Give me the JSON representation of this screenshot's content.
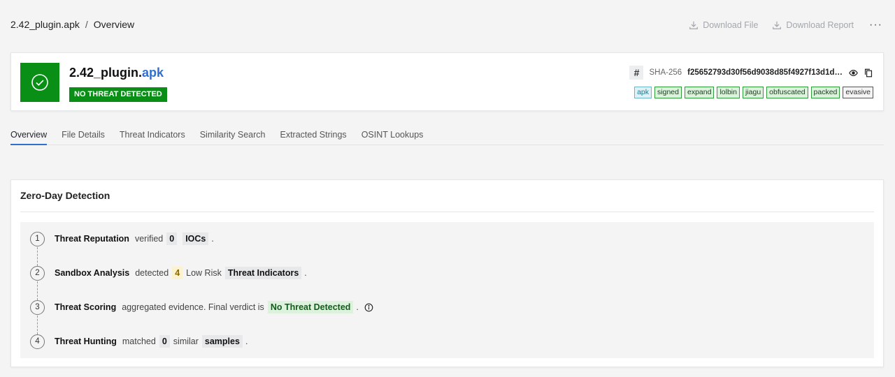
{
  "breadcrumb": {
    "file": "2.42_plugin.apk",
    "separator": "/",
    "page": "Overview"
  },
  "actions": {
    "download_file": "Download File",
    "download_report": "Download Report",
    "more": "···"
  },
  "file": {
    "name_base": "2.42_plugin.",
    "name_ext": "apk",
    "verdict": "NO THREAT DETECTED",
    "hash_symbol": "#",
    "hash_label": "SHA-256",
    "hash_value": "f25652793d30f56d9038d85f4927f13d1d…",
    "tags": [
      "apk",
      "signed",
      "expand",
      "lolbin",
      "jiagu",
      "obfuscated",
      "packed",
      "evasive"
    ]
  },
  "tabs": [
    "Overview",
    "File Details",
    "Threat Indicators",
    "Similarity Search",
    "Extracted Strings",
    "OSINT Lookups"
  ],
  "panel": {
    "title": "Zero-Day Detection",
    "steps": [
      {
        "num": "1",
        "label": "Threat Reputation",
        "t1": "verified",
        "chip1": "0",
        "chip2": "IOCs",
        "end": "."
      },
      {
        "num": "2",
        "label": "Sandbox Analysis",
        "t1": "detected",
        "chip1": "4",
        "t2": "Low Risk",
        "chip2": "Threat Indicators",
        "end": "."
      },
      {
        "num": "3",
        "label": "Threat Scoring",
        "t1": "aggregated evidence. Final verdict is",
        "chip1": "No Threat Detected",
        "end": "."
      },
      {
        "num": "4",
        "label": "Threat Hunting",
        "t1": "matched",
        "chip1": "0",
        "t2": "similar",
        "chip2": "samples",
        "end": "."
      }
    ]
  },
  "colors": {
    "accent": "#2f6fd1",
    "success": "#0a8f16"
  }
}
